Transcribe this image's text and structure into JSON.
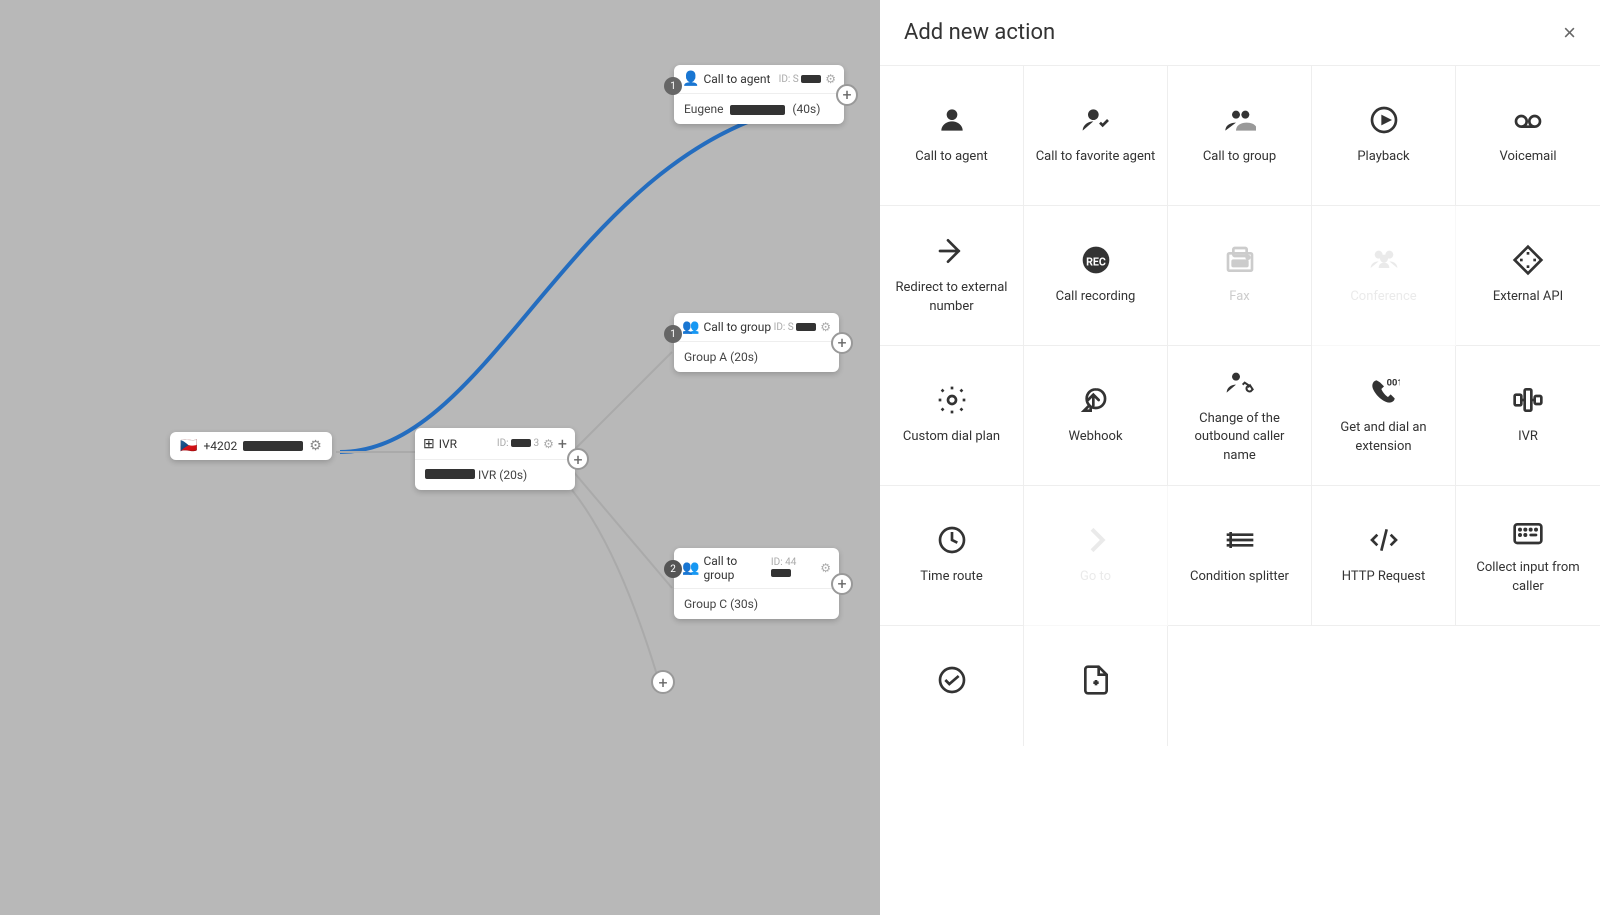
{
  "panel": {
    "title": "Add new action",
    "close_label": "×"
  },
  "actions": [
    {
      "id": "call-to-agent",
      "label": "Call to agent",
      "icon": "person",
      "disabled": false
    },
    {
      "id": "call-to-favorite-agent",
      "label": "Call to favorite agent",
      "icon": "person-check",
      "disabled": false
    },
    {
      "id": "call-to-group",
      "label": "Call to group",
      "icon": "group",
      "disabled": false
    },
    {
      "id": "playback",
      "label": "Playback",
      "icon": "play-circle",
      "disabled": false
    },
    {
      "id": "voicemail",
      "label": "Voicemail",
      "icon": "voicemail",
      "disabled": false
    },
    {
      "id": "redirect-to-external",
      "label": "Redirect to external number",
      "icon": "redirect",
      "disabled": false
    },
    {
      "id": "call-recording",
      "label": "Call recording",
      "icon": "rec",
      "disabled": false
    },
    {
      "id": "fax",
      "label": "Fax",
      "icon": "fax",
      "disabled": false
    },
    {
      "id": "conference",
      "label": "Conference",
      "icon": "conference",
      "disabled": true
    },
    {
      "id": "external-api",
      "label": "External API",
      "icon": "diamond",
      "disabled": false
    },
    {
      "id": "custom-dial-plan",
      "label": "Custom dial plan",
      "icon": "gear",
      "disabled": false
    },
    {
      "id": "webhook",
      "label": "Webhook",
      "icon": "webhook",
      "disabled": false
    },
    {
      "id": "change-outbound-caller",
      "label": "Change of the outbound caller name",
      "icon": "contact-phone",
      "disabled": false
    },
    {
      "id": "get-dial-extension",
      "label": "Get and dial an extension",
      "icon": "phone-001",
      "disabled": false
    },
    {
      "id": "ivr",
      "label": "IVR",
      "icon": "ivr",
      "disabled": false
    },
    {
      "id": "time-route",
      "label": "Time route",
      "icon": "clock",
      "disabled": false
    },
    {
      "id": "go-to",
      "label": "Go to",
      "icon": "chevron-right",
      "disabled": true
    },
    {
      "id": "condition-splitter",
      "label": "Condition splitter",
      "icon": "condition",
      "disabled": false
    },
    {
      "id": "http-request",
      "label": "HTTP Request",
      "icon": "code",
      "disabled": false
    },
    {
      "id": "collect-input",
      "label": "Collect input from caller",
      "icon": "keyboard",
      "disabled": false
    },
    {
      "id": "check-circle",
      "label": "",
      "icon": "check-circle",
      "disabled": false
    },
    {
      "id": "add-file",
      "label": "",
      "icon": "file-plus",
      "disabled": false
    }
  ],
  "nodes": {
    "phone": {
      "number": "+4202",
      "bar": true
    },
    "ivr": {
      "title": "IVR",
      "id": "ID:",
      "label": "IVR (20s)"
    },
    "call_to_agent": {
      "title": "Call to agent",
      "id": "ID: S",
      "agent": "Eugene",
      "duration": "(40s)"
    },
    "call_group_1": {
      "title": "Call to group",
      "id": "ID: S",
      "group": "Group A (20s)",
      "connector": "1"
    },
    "call_group_2": {
      "title": "Call to group",
      "id": "ID: 44",
      "group": "Group C (30s)",
      "connector": "2"
    }
  }
}
